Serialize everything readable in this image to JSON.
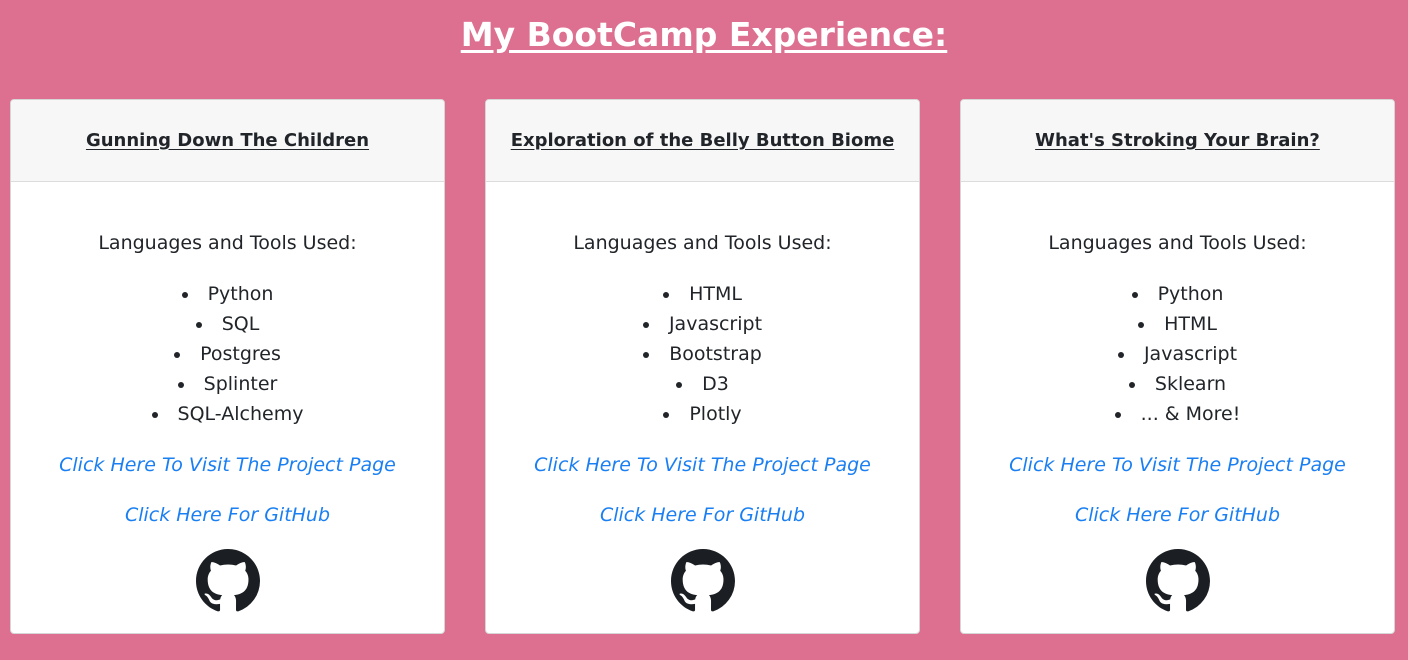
{
  "page": {
    "title": "My BootCamp Experience:"
  },
  "cards": [
    {
      "title": "Gunning Down The Children",
      "tools_label": "Languages and Tools Used:",
      "tools": [
        "Python",
        "SQL",
        "Postgres",
        "Splinter",
        "SQL-Alchemy"
      ],
      "project_link": "Click Here To Visit The Project Page",
      "github_link": "Click Here For GitHub",
      "icon": "github-icon"
    },
    {
      "title": "Exploration of the Belly Button Biome",
      "tools_label": "Languages and Tools Used:",
      "tools": [
        "HTML",
        "Javascript",
        "Bootstrap",
        "D3",
        "Plotly"
      ],
      "project_link": "Click Here To Visit The Project Page",
      "github_link": "Click Here For GitHub",
      "icon": "github-icon"
    },
    {
      "title": "What's Stroking Your Brain?",
      "tools_label": "Languages and Tools Used:",
      "tools": [
        "Python",
        "HTML",
        "Javascript",
        "Sklearn",
        "... & More!"
      ],
      "project_link": "Click Here To Visit The Project Page",
      "github_link": "Click Here For GitHub",
      "icon": "github-icon"
    }
  ],
  "colors": {
    "background": "#dd7090",
    "link": "#1a7ff2",
    "card_header": "#f7f7f7",
    "text": "#212529"
  }
}
